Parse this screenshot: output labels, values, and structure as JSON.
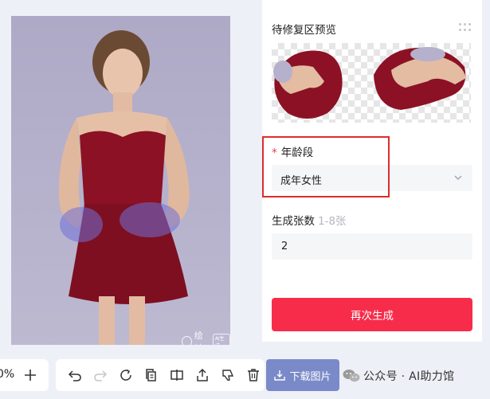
{
  "preview": {
    "title": "待修复区预览"
  },
  "age_group": {
    "required_mark": "*",
    "label": "年龄段",
    "selected": "成年女性"
  },
  "image_count": {
    "label": "生成张数",
    "hint": "1-8张",
    "value": "2"
  },
  "regenerate_label": "再次生成",
  "zoom": {
    "value": "0%"
  },
  "toolbar": {
    "tools": [
      "undo-icon",
      "redo-icon",
      "refresh-icon",
      "copy-icon",
      "compare-icon",
      "share-icon",
      "dislike-icon",
      "delete-icon"
    ]
  },
  "download_label": "下载图片",
  "photo": {
    "watermark_text": "绘蛙",
    "watermark_badge": "AI生成"
  },
  "watermark_account": "公众号 · AI助力馆",
  "colors": {
    "accent": "#f72c4a",
    "download": "#7a8ac8",
    "highlight_border": "#e02b2b",
    "dress": "#8c1124"
  }
}
